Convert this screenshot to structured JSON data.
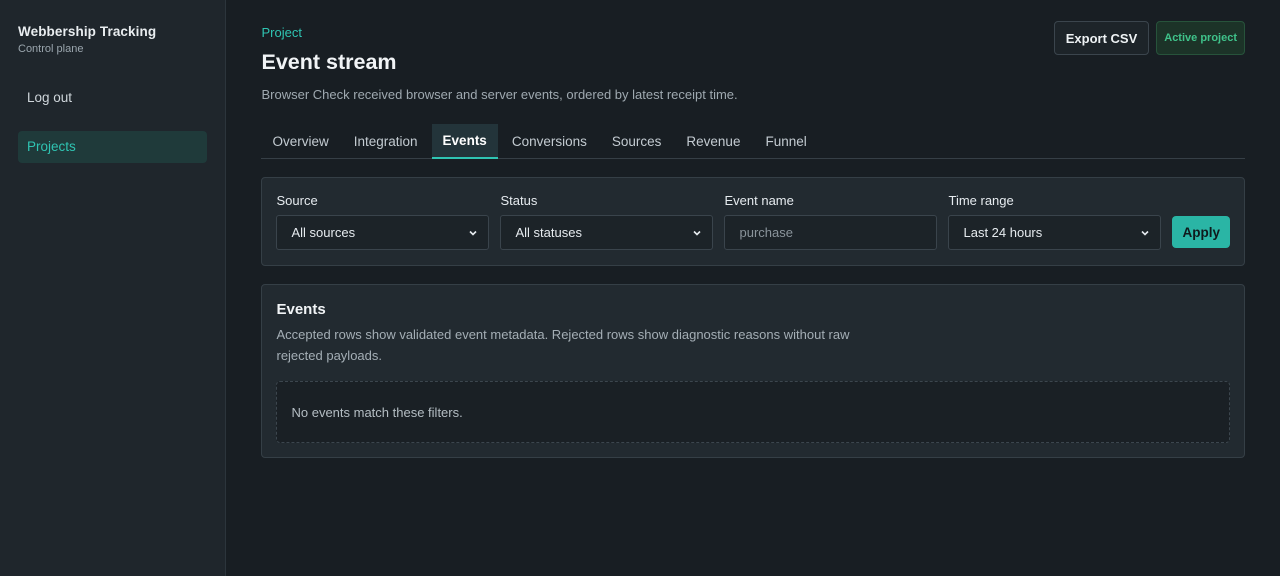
{
  "sidebar": {
    "brand_title": "Webbership Tracking",
    "brand_sub": "Control plane",
    "items": [
      {
        "label": "Log out"
      },
      {
        "label": "Projects"
      }
    ]
  },
  "header": {
    "crumb": "Project",
    "title": "Event stream",
    "description": "Browser Check received browser and server events, ordered by latest receipt time.",
    "export_label": "Export CSV",
    "badge_label": "Active project"
  },
  "tabs": [
    {
      "label": "Overview"
    },
    {
      "label": "Integration"
    },
    {
      "label": "Events"
    },
    {
      "label": "Conversions"
    },
    {
      "label": "Sources"
    },
    {
      "label": "Revenue"
    },
    {
      "label": "Funnel"
    }
  ],
  "filters": {
    "source": {
      "label": "Source",
      "value": "All sources"
    },
    "status": {
      "label": "Status",
      "value": "All statuses"
    },
    "event_name": {
      "label": "Event name",
      "placeholder": "purchase"
    },
    "time_range": {
      "label": "Time range",
      "value": "Last 24 hours"
    },
    "apply_label": "Apply"
  },
  "events": {
    "title": "Events",
    "description": "Accepted rows show validated event metadata. Rejected rows show diagnostic reasons without raw rejected payloads.",
    "empty_text": "No events match these filters."
  },
  "colors": {
    "accent": "#2fc4b2",
    "background": "#181e23",
    "badge_green": "#3fc28a"
  }
}
